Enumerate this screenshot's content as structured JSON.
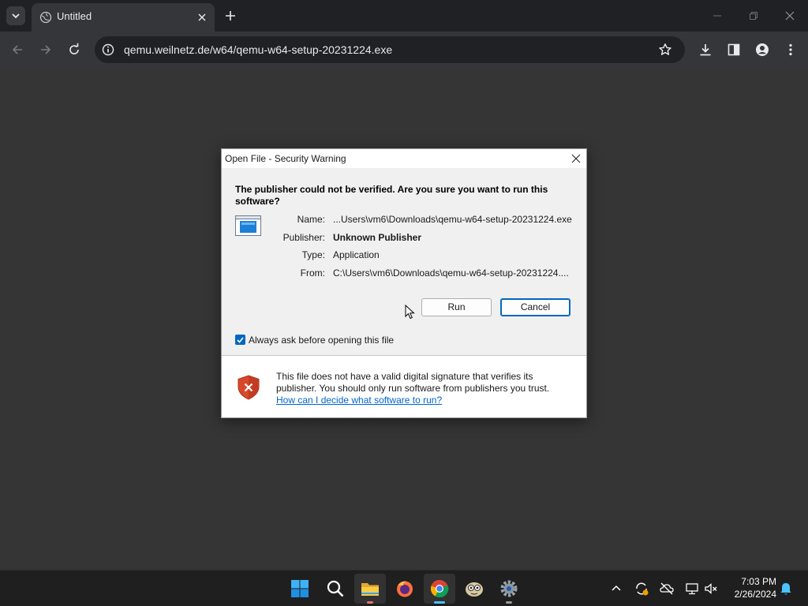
{
  "browser": {
    "tab": {
      "title": "Untitled"
    },
    "url": "qemu.weilnetz.de/w64/qemu-w64-setup-20231224.exe"
  },
  "dialog": {
    "title": "Open File - Security Warning",
    "heading": "The publisher could not be verified.  Are you sure you want to run this software?",
    "fields": [
      {
        "label": "Name:",
        "value": "...Users\\vm6\\Downloads\\qemu-w64-setup-20231224.exe"
      },
      {
        "label": "Publisher:",
        "value": "Unknown Publisher"
      },
      {
        "label": "Type:",
        "value": "Application"
      },
      {
        "label": "From:",
        "value": "C:\\Users\\vm6\\Downloads\\qemu-w64-setup-20231224...."
      }
    ],
    "run_label": "Run",
    "cancel_label": "Cancel",
    "checkbox_label": "Always ask before opening this file",
    "checkbox_checked": true,
    "warning_text": "This file does not have a valid digital signature that verifies its publisher.  You should only run software from publishers you trust.",
    "help_link": "How can I decide what software to run?"
  },
  "taskbar": {
    "apps": [
      "start-icon",
      "search-icon",
      "file-explorer-icon",
      "firefox-icon",
      "chrome-icon",
      "qemu-app-icon",
      "settings-icon"
    ],
    "active_app": "chrome-icon",
    "time": "7:03 PM",
    "date": "2/26/2024"
  },
  "colors": {
    "accent": "#0067c0",
    "link": "#0066cc",
    "shield_red": "#d9482b",
    "page_background": "#353535"
  }
}
